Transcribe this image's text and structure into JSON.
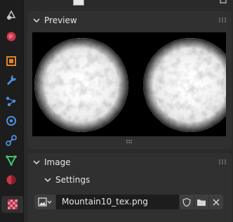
{
  "sidebar": {
    "tools": [
      {
        "icon": "scene-data-icon"
      },
      {
        "icon": "world-icon"
      },
      {
        "icon": "object-icon"
      },
      {
        "icon": "modifier-wrench-icon"
      },
      {
        "icon": "particles-icon"
      },
      {
        "icon": "physics-icon"
      },
      {
        "icon": "constraints-icon"
      },
      {
        "icon": "object-data-icon"
      },
      {
        "icon": "material-icon"
      },
      {
        "icon": "texture-icon",
        "active": true
      }
    ]
  },
  "preview_panel": {
    "title": "Preview"
  },
  "image_panel": {
    "title": "Image",
    "settings": {
      "title": "Settings"
    },
    "image_name": "Mountain10_tex.png"
  },
  "colors": {
    "panel_bg": "#303030",
    "header_text": "#e6e6e6",
    "field_bg": "#1d1d1d",
    "button_bg": "#3e3e3e"
  }
}
